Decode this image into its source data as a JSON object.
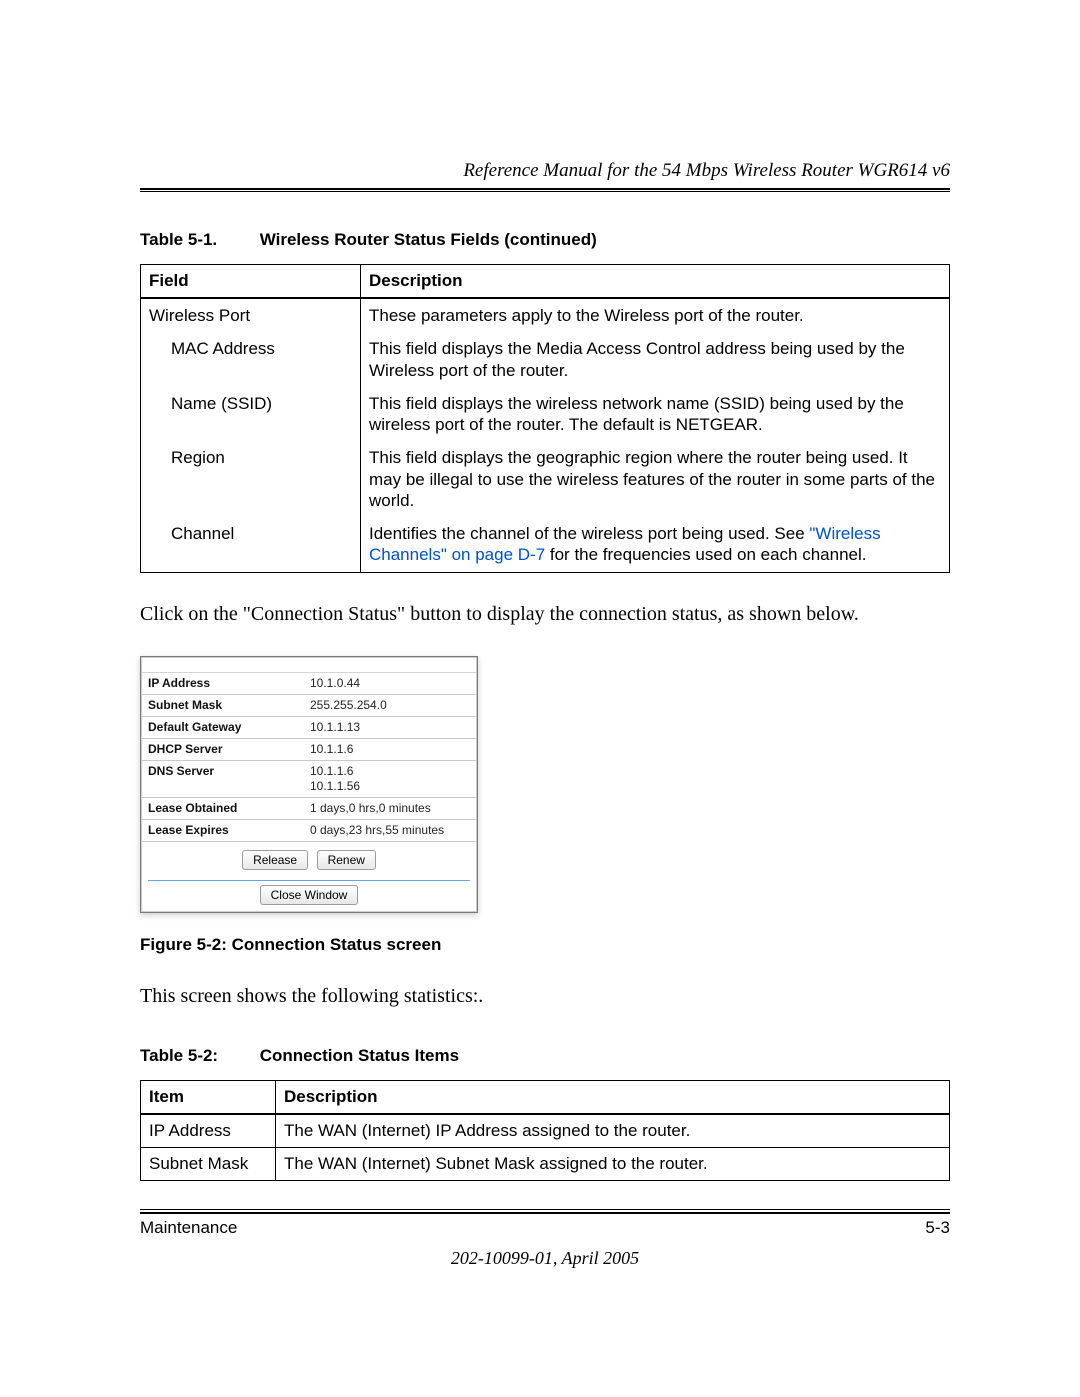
{
  "header": {
    "title": "Reference Manual for the 54 Mbps Wireless Router WGR614 v6"
  },
  "table1": {
    "number": "Table 5-1.",
    "title": "Wireless Router Status Fields  (continued)",
    "col_field": "Field",
    "col_desc": "Description",
    "rows": [
      {
        "field": "Wireless Port",
        "indent": false,
        "desc": "These parameters apply to the Wireless port of the router."
      },
      {
        "field": "MAC Address",
        "indent": true,
        "desc": "This field displays the Media Access Control address being used by the Wireless port of the router."
      },
      {
        "field": "Name (SSID)",
        "indent": true,
        "desc": "This field displays the wireless network name (SSID) being used by the wireless port of the router. The default is NETGEAR."
      },
      {
        "field": "Region",
        "indent": true,
        "desc": "This field displays the geographic region where the router being used. It may be illegal to use the wireless features of the router in some parts of the world."
      },
      {
        "field": "Channel",
        "indent": true,
        "desc_pre": "Identifies the channel of the wireless port being used. See ",
        "desc_link": "\"Wireless Channels\" on page D-7",
        "desc_post": " for the frequencies used on each channel."
      }
    ]
  },
  "para1": "Click on the \"Connection Status\" button to display the connection status, as shown below.",
  "conn_status": {
    "rows": [
      {
        "label": "IP Address",
        "value": "10.1.0.44"
      },
      {
        "label": "Subnet Mask",
        "value": "255.255.254.0"
      },
      {
        "label": "Default Gateway",
        "value": "10.1.1.13"
      },
      {
        "label": "DHCP Server",
        "value": "10.1.1.6"
      },
      {
        "label": "DNS Server",
        "value": "10.1.1.6\n10.1.1.56"
      },
      {
        "label": "Lease Obtained",
        "value": "1 days,0 hrs,0 minutes"
      },
      {
        "label": "Lease Expires",
        "value": "0 days,23 hrs,55 minutes"
      }
    ],
    "buttons": {
      "release": "Release",
      "renew": "Renew",
      "close": "Close Window"
    }
  },
  "figure": {
    "caption": "Figure 5-2:  Connection Status screen"
  },
  "para2": "This screen shows the following statistics:.",
  "table2": {
    "number": "Table 5-2:",
    "title": "Connection Status Items",
    "col_item": "Item",
    "col_desc": "Description",
    "rows": [
      {
        "item": "IP Address",
        "desc": "The WAN (Internet) IP Address assigned to the router."
      },
      {
        "item": "Subnet Mask",
        "desc": "The WAN (Internet) Subnet Mask assigned to the router."
      }
    ]
  },
  "footer": {
    "left": "Maintenance",
    "right": "5-3",
    "docid": "202-10099-01, April 2005"
  }
}
